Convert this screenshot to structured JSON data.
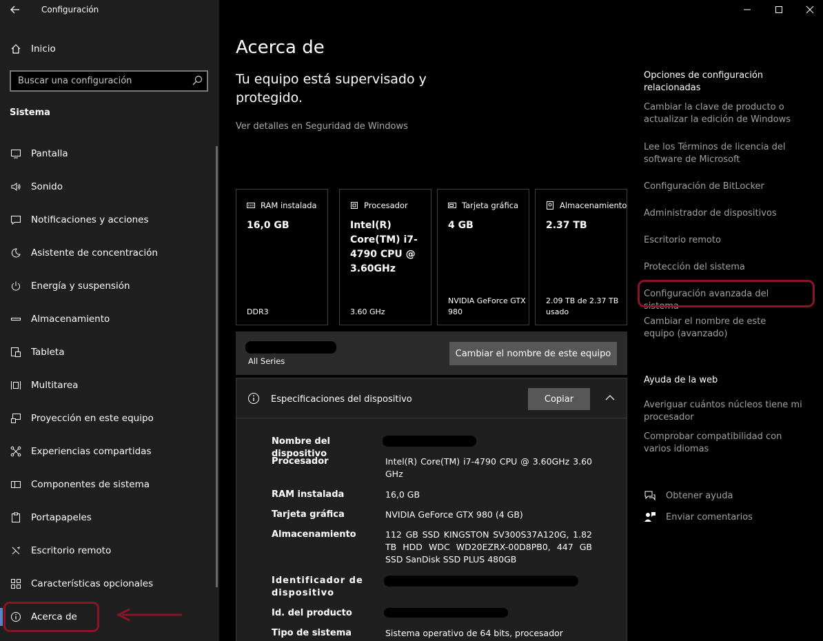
{
  "window": {
    "title": "Configuración"
  },
  "sidebar": {
    "home_label": "Inicio",
    "search_placeholder": "Buscar una configuración",
    "section": "Sistema",
    "items": [
      {
        "label": "Pantalla",
        "icon": "monitor-icon"
      },
      {
        "label": "Sonido",
        "icon": "speaker-icon"
      },
      {
        "label": "Notificaciones y acciones",
        "icon": "notification-icon"
      },
      {
        "label": "Asistente de concentración",
        "icon": "moon-icon"
      },
      {
        "label": "Energía y suspensión",
        "icon": "power-icon"
      },
      {
        "label": "Almacenamiento",
        "icon": "storage-icon"
      },
      {
        "label": "Tableta",
        "icon": "tablet-icon"
      },
      {
        "label": "Multitarea",
        "icon": "multitask-icon"
      },
      {
        "label": "Proyección en este equipo",
        "icon": "projection-icon"
      },
      {
        "label": "Experiencias compartidas",
        "icon": "shared-icon"
      },
      {
        "label": "Componentes de sistema",
        "icon": "components-icon"
      },
      {
        "label": "Portapapeles",
        "icon": "clipboard-icon"
      },
      {
        "label": "Escritorio remoto",
        "icon": "remote-icon"
      },
      {
        "label": "Características opcionales",
        "icon": "optional-features-icon"
      },
      {
        "label": "Acerca de",
        "icon": "info-icon",
        "selected": true
      }
    ]
  },
  "main": {
    "title": "Acerca de",
    "security_status": "Tu equipo está supervisado y protegido.",
    "security_link": "Ver detalles en Seguridad de Windows",
    "cards": [
      {
        "label": "RAM instalada",
        "value": "16,0 GB",
        "sub": "DDR3",
        "icon": "ram-icon"
      },
      {
        "label": "Procesador",
        "value": "Intel(R) Core(TM) i7-4790 CPU @ 3.60GHz",
        "sub": "3.60 GHz",
        "icon": "cpu-icon"
      },
      {
        "label": "Tarjeta gráfica",
        "value": "4 GB",
        "sub": "NVIDIA GeForce GTX 980",
        "icon": "gpu-icon"
      },
      {
        "label": "Almacenamiento",
        "value": "2.37 TB",
        "sub": "2.09 TB de 2.37 TB usado",
        "icon": "drive-icon"
      }
    ],
    "device_model": "All Series",
    "rename_button": "Cambiar el nombre de este equipo",
    "specs": {
      "title": "Especificaciones del dispositivo",
      "copy_button": "Copiar",
      "rows": [
        {
          "label": "Nombre del dispositivo",
          "value": ""
        },
        {
          "label": "Procesador",
          "value": "Intel(R) Core(TM) i7-4790 CPU @ 3.60GHz   3.60 GHz"
        },
        {
          "label": "RAM instalada",
          "value": "16,0 GB"
        },
        {
          "label": "Tarjeta gráfica",
          "value": "NVIDIA GeForce GTX 980 (4 GB)"
        },
        {
          "label": "Almacenamiento",
          "value": "112 GB SSD KINGSTON SV300S37A120G, 1.82 TB HDD WDC WD20EZRX-00D8PB0, 447 GB SSD SanDisk SSD PLUS 480GB"
        },
        {
          "label": "Identificador de dispositivo",
          "value": ""
        },
        {
          "label": "Id. del producto",
          "value": ""
        },
        {
          "label": "Tipo de sistema",
          "value": "Sistema operativo de 64 bits, procesador"
        }
      ]
    }
  },
  "related": {
    "heading": "Opciones de configuración relacionadas",
    "links": [
      "Cambiar la clave de producto o actualizar la edición de Windows",
      "Lee los Términos de licencia del software de Microsoft",
      "Configuración de BitLocker",
      "Administrador de dispositivos",
      "Escritorio remoto",
      "Protección del sistema",
      "Configuración avanzada del sistema",
      "Cambiar el nombre de este equipo (avanzado)"
    ],
    "web_help_heading": "Ayuda de la web",
    "web_help_links": [
      "Averiguar cuántos núcleos tiene mi procesador",
      "Comprobar compatibilidad con varios idiomas"
    ],
    "get_help": "Obtener ayuda",
    "feedback": "Enviar comentarios"
  },
  "colors": {
    "annotation": "#8b1525",
    "accent": "#5b84c4"
  }
}
